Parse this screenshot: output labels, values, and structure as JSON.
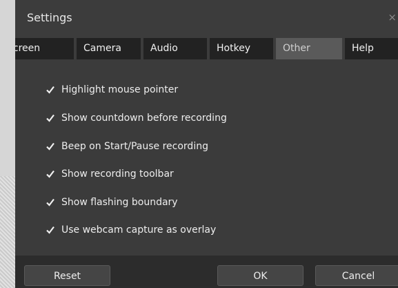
{
  "window": {
    "title": "Settings",
    "close_glyph": "×"
  },
  "tabs": [
    {
      "label": "Screen",
      "active": false
    },
    {
      "label": "Camera",
      "active": false
    },
    {
      "label": "Audio",
      "active": false
    },
    {
      "label": "Hotkey",
      "active": false
    },
    {
      "label": "Other",
      "active": true
    },
    {
      "label": "Help",
      "active": false
    }
  ],
  "options": [
    {
      "label": "Highlight mouse pointer",
      "checked": true
    },
    {
      "label": "Show countdown before recording",
      "checked": true
    },
    {
      "label": "Beep on Start/Pause recording",
      "checked": true
    },
    {
      "label": "Show recording toolbar",
      "checked": true
    },
    {
      "label": "Show flashing boundary",
      "checked": true
    },
    {
      "label": "Use webcam capture as overlay",
      "checked": true
    }
  ],
  "footer": {
    "reset_label": "Reset",
    "ok_label": "OK",
    "cancel_label": "Cancel"
  },
  "colors": {
    "background": "#3b3b3b",
    "tab_bg": "#222222",
    "tab_active_bg": "#5a5a5a",
    "checkmark": "#f0f0f0"
  }
}
